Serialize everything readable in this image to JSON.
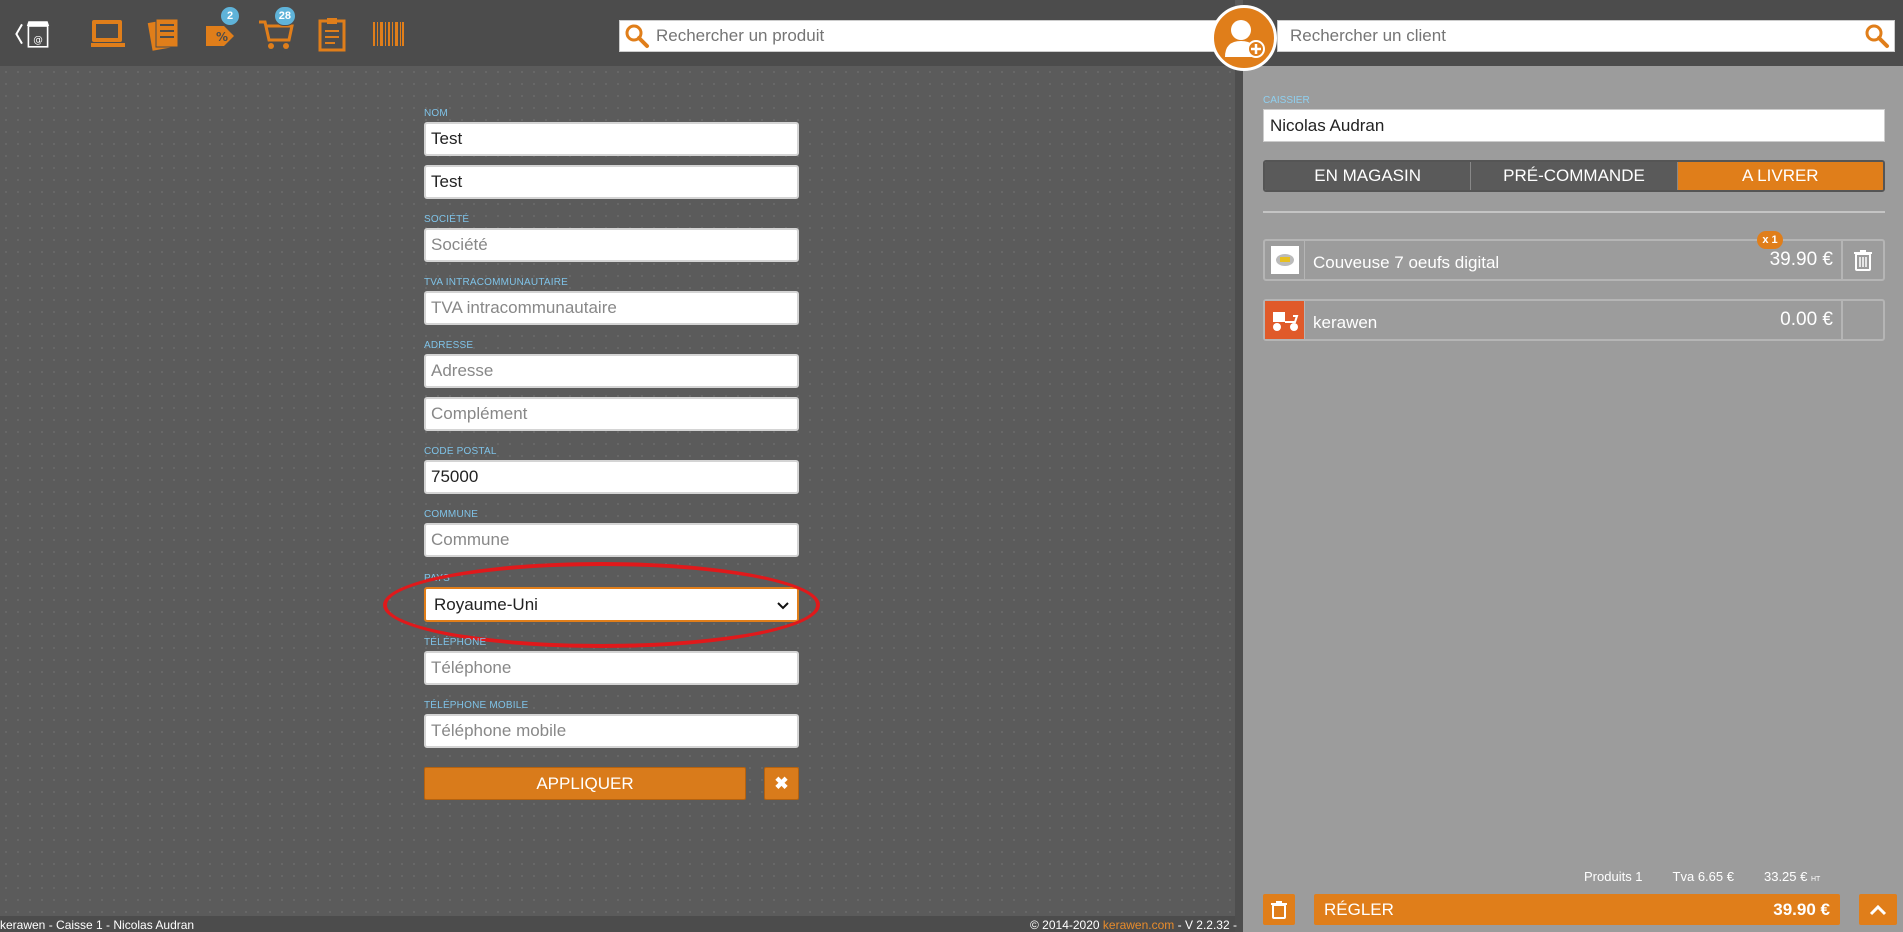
{
  "toolbar": {
    "icons": [
      {
        "name": "back-shop-icon"
      },
      {
        "name": "screen-icon"
      },
      {
        "name": "documents-icon"
      },
      {
        "name": "discount-icon",
        "badge": "2"
      },
      {
        "name": "cart-icon",
        "badge": "28"
      },
      {
        "name": "clipboard-icon"
      },
      {
        "name": "barcode-icon"
      }
    ],
    "search_product_placeholder": "Rechercher un produit",
    "search_client_placeholder": "Rechercher un client"
  },
  "form": {
    "nom_label": "NOM",
    "nom_value": "Test",
    "prenom_value": "Test",
    "societe_label": "SOCIÉTÉ",
    "societe_placeholder": "Société",
    "tva_label": "TVA INTRACOMMUNAUTAIRE",
    "tva_placeholder": "TVA intracommunautaire",
    "adresse_label": "ADRESSE",
    "adresse_placeholder": "Adresse",
    "complement_placeholder": "Complément",
    "cp_label": "CODE POSTAL",
    "cp_value": "75000",
    "commune_label": "COMMUNE",
    "commune_placeholder": "Commune",
    "pays_label": "PAYS",
    "pays_value": "Royaume-Uni",
    "tel_label": "TÉLÉPHONE",
    "tel_placeholder": "Téléphone",
    "mobile_label": "TÉLÉPHONE MOBILE",
    "mobile_placeholder": "Téléphone mobile",
    "apply_label": "APPLIQUER",
    "close_label": "✖"
  },
  "footer": {
    "left": "kerawen - Caisse 1 - Nicolas Audran",
    "copyright": "© 2014-2020 ",
    "link": "kerawen.com",
    "version": " - V 2.2.32 -"
  },
  "right": {
    "cashier_label": "CAISSIER",
    "cashier_value": "Nicolas Audran",
    "tabs": [
      {
        "label": "EN MAGASIN",
        "active": false
      },
      {
        "label": "PRÉ-COMMANDE",
        "active": false
      },
      {
        "label": "A LIVRER",
        "active": true
      }
    ],
    "cart": [
      {
        "name": "Couveuse 7 oeufs digital",
        "price": "39.90 €",
        "qty": "x 1"
      },
      {
        "name": "kerawen",
        "price": "0.00 €"
      }
    ],
    "totals": {
      "products": "Produits 1",
      "tva": "Tva 6.65 €",
      "ht_amount": "33.25 €",
      "ht_unit": "HT"
    },
    "pay_label": "RÉGLER",
    "pay_amount": "39.90 €"
  },
  "colors": {
    "accent": "#e07e1a",
    "highlight": "#e0191b",
    "label_blue": "#7fc3e8"
  }
}
